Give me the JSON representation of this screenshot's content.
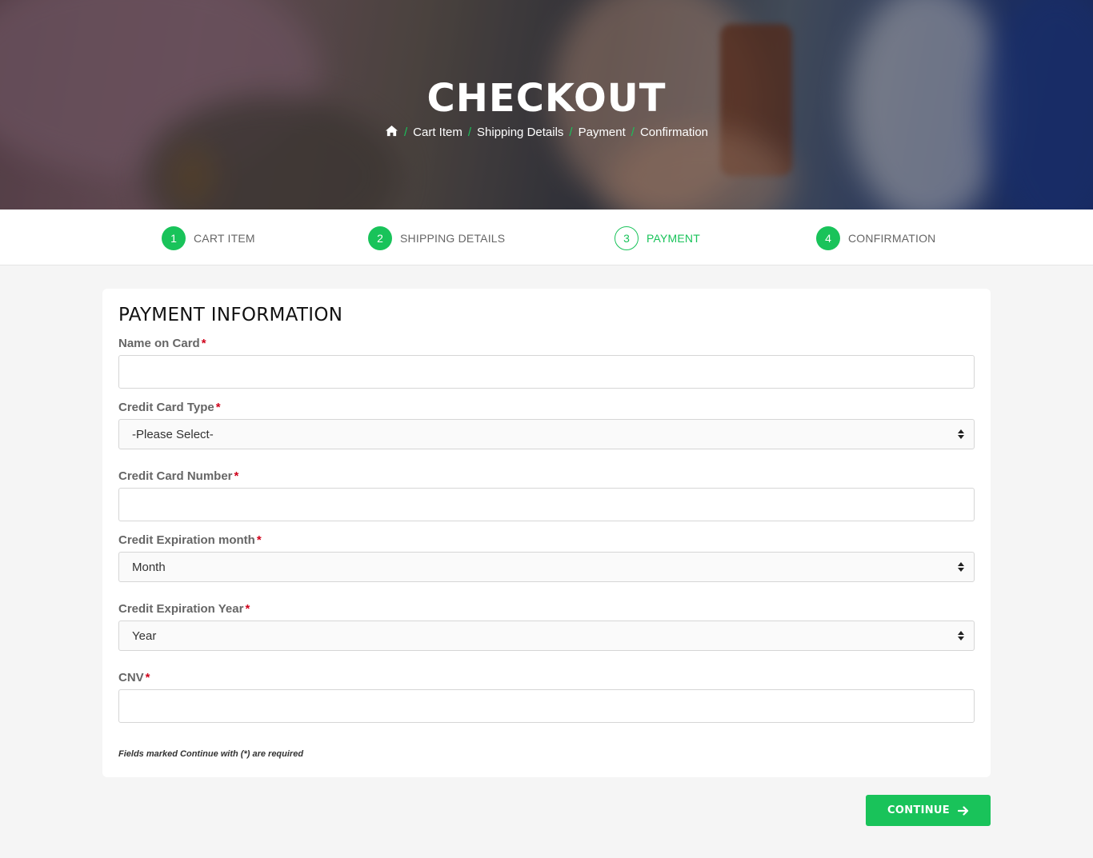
{
  "hero": {
    "title": "CHECKOUT",
    "breadcrumb": [
      "Cart Item",
      "Shipping Details",
      "Payment",
      "Confirmation"
    ],
    "breadcrumb_separator": "/",
    "home_icon": "home-icon"
  },
  "steps": [
    {
      "number": "1",
      "label": "CART ITEM"
    },
    {
      "number": "2",
      "label": "SHIPPING DETAILS"
    },
    {
      "number": "3",
      "label": "PAYMENT"
    },
    {
      "number": "4",
      "label": "CONFIRMATION"
    }
  ],
  "active_step": 3,
  "form": {
    "title": "PAYMENT INFORMATION",
    "required_mark": "*",
    "fields": {
      "name_on_card": {
        "label": "Name on Card",
        "value": ""
      },
      "card_type": {
        "label": "Credit Card Type",
        "selected": "-Please Select-"
      },
      "card_number": {
        "label": "Credit Card Number",
        "value": ""
      },
      "exp_month": {
        "label": "Credit Expiration month",
        "selected": "Month"
      },
      "exp_year": {
        "label": "Credit Expiration Year",
        "selected": "Year"
      },
      "cnv": {
        "label": "CNV",
        "value": ""
      }
    },
    "note": "Fields marked Continue with (*) are required"
  },
  "continue_button": {
    "label": "CONTINUE",
    "icon": "arrow-right-icon"
  },
  "colors": {
    "accent": "#19c35a",
    "required": "#d0021b",
    "page_bg": "#f5f5f5"
  }
}
